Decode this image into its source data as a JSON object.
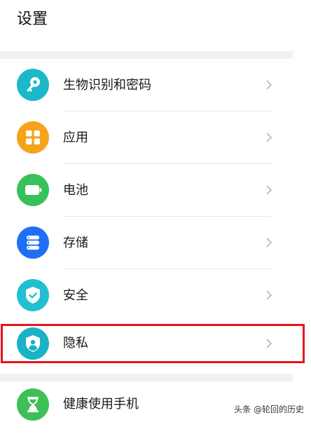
{
  "header": {
    "title": "设置"
  },
  "items": [
    {
      "label": "生物识别和密码",
      "icon": "key-icon",
      "color": "#1bb8c9"
    },
    {
      "label": "应用",
      "icon": "apps-grid-icon",
      "color": "#f7a21b"
    },
    {
      "label": "电池",
      "icon": "battery-icon",
      "color": "#37c15a"
    },
    {
      "label": "存储",
      "icon": "storage-icon",
      "color": "#1f6ff5"
    },
    {
      "label": "安全",
      "icon": "shield-check-icon",
      "color": "#22bfd0"
    },
    {
      "label": "隐私",
      "icon": "privacy-shield-icon",
      "color": "#1ab2c6"
    },
    {
      "label": "健康使用手机",
      "icon": "hourglass-icon",
      "color": "#3fbf58"
    }
  ],
  "highlight_color": "#e8141c",
  "watermark": "头条 @轮回的历史"
}
